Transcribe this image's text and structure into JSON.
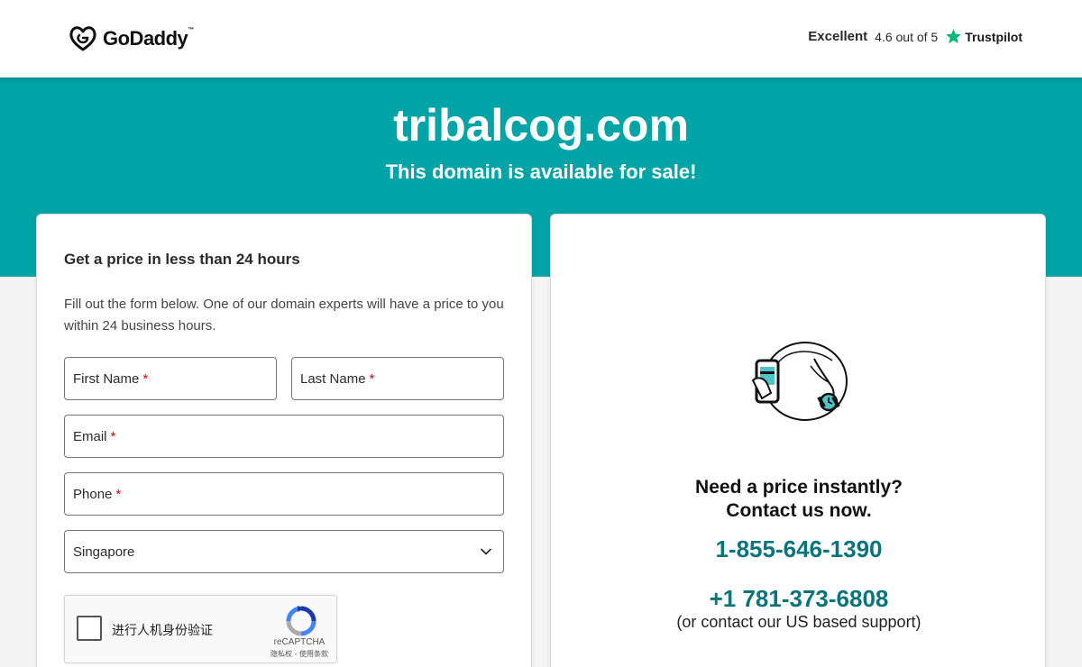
{
  "header": {
    "logo_text": "GoDaddy",
    "logo_tm": "™",
    "trust_rating": "Excellent",
    "trust_score": "4.6 out of 5",
    "trust_brand": "Trustpilot",
    "trust_star_color": "#00b67a"
  },
  "hero": {
    "domain": "tribalcog.com",
    "subtitle": "This domain is available for sale!",
    "bg_color": "#00a4a6"
  },
  "form": {
    "title": "Get a price in less than 24 hours",
    "description": "Fill out the form below. One of our domain experts will have a price to you within 24 business hours.",
    "first_name_label": "First Name",
    "last_name_label": "Last Name",
    "email_label": "Email",
    "phone_label": "Phone",
    "required_mark": "*",
    "country_selected": "Singapore",
    "recaptcha": {
      "label": "进行人机身份验证",
      "brand": "reCAPTCHA",
      "links": "隐私权 - 使用条款"
    }
  },
  "contact": {
    "title_line1": "Need a price instantly?",
    "title_line2": "Contact us now.",
    "phone_primary": "1-855-646-1390",
    "phone_secondary": "+1 781-373-6808",
    "support_note": "(or contact our US based support)",
    "link_color": "#09757a"
  }
}
